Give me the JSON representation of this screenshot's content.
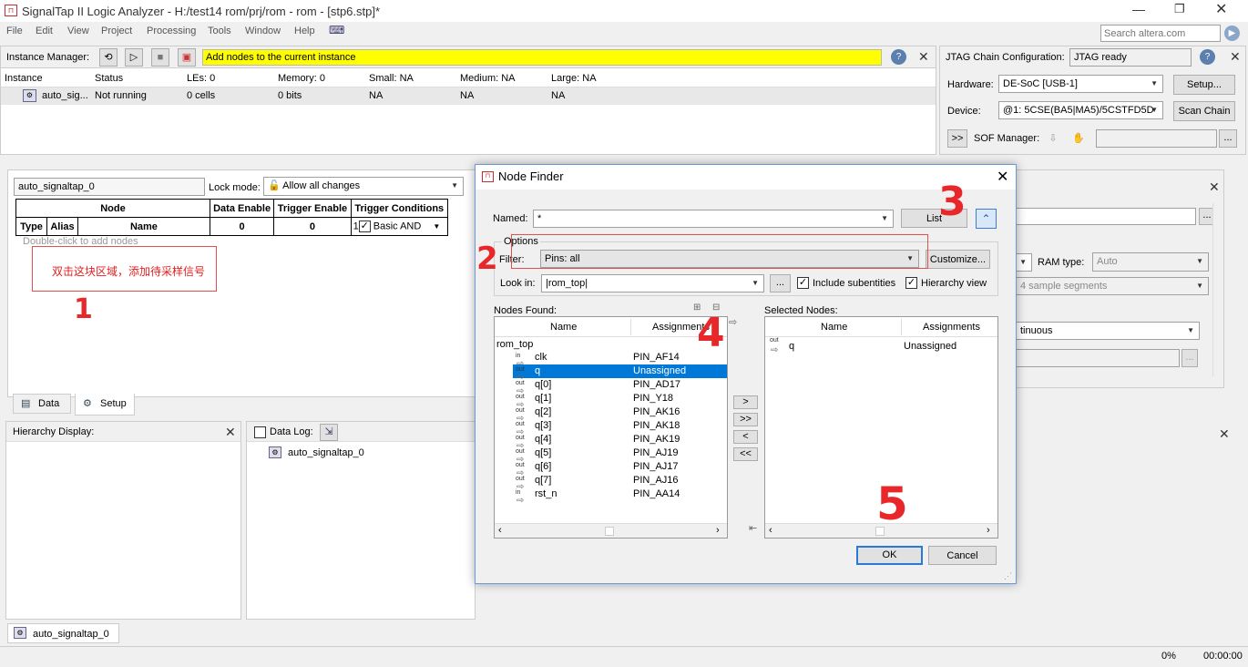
{
  "window": {
    "title": "SignalTap II Logic Analyzer - H:/test14 rom/prj/rom - rom - [stp6.stp]*",
    "search_placeholder": "Search altera.com"
  },
  "menu": [
    "File",
    "Edit",
    "View",
    "Project",
    "Processing",
    "Tools",
    "Window",
    "Help"
  ],
  "instance_manager": {
    "label": "Instance Manager:",
    "message": "Add nodes to the current instance",
    "columns": [
      "Instance",
      "Status",
      "LEs: 0",
      "Memory: 0",
      "Small: NA",
      "Medium: NA",
      "Large: NA"
    ],
    "row": [
      "auto_sig...",
      "Not running",
      "0 cells",
      "0 bits",
      "NA",
      "NA",
      "NA"
    ]
  },
  "jtag": {
    "label": "JTAG Chain Configuration:",
    "status": "JTAG ready",
    "hardware_label": "Hardware:",
    "hardware": "DE-SoC [USB-1]",
    "setup": "Setup...",
    "device_label": "Device:",
    "device": "@1: 5CSE(BA5|MA5)/5CSTFD5D",
    "scan_chain": "Scan Chain",
    "sof_button": ">>",
    "sof_label": "SOF Manager:"
  },
  "setup_pane": {
    "instance": "auto_signaltap_0",
    "lock_mode_label": "Lock mode:",
    "lock_mode": "Allow all changes",
    "headers": {
      "node": "Node",
      "data_enable": "Data Enable",
      "trigger_enable": "Trigger Enable",
      "trigger_conditions": "Trigger Conditions",
      "type": "Type",
      "alias": "Alias",
      "name": "Name",
      "data_count": "0",
      "trigger_count": "0",
      "cond_num": "1",
      "basic_and": "Basic AND"
    },
    "hint": "Double-click to add nodes",
    "note": "双击这块区域，添加待采样信号",
    "tabs": [
      "Data",
      "Setup"
    ]
  },
  "right_behind": {
    "ram_type_label": "RAM type:",
    "ram_type": "Auto",
    "sample_segments": "4 sample segments",
    "continuous": "tinuous"
  },
  "hierarchy": {
    "label": "Hierarchy Display:"
  },
  "data_log": {
    "label": "Data Log:",
    "item": "auto_signaltap_0"
  },
  "bottom_tab": "auto_signaltap_0",
  "status_bar": {
    "progress": "0%",
    "time": "00:00:00"
  },
  "node_finder": {
    "title": "Node Finder",
    "named_label": "Named:",
    "named_value": "*",
    "list_button": "List",
    "options_label": "Options",
    "filter_label": "Filter:",
    "filter_value": "Pins: all",
    "customize_button": "Customize...",
    "lookin_label": "Look in:",
    "lookin_value": "|rom_top|",
    "browse_button": "...",
    "include_subentities": "Include subentities",
    "hierarchy_view": "Hierarchy view",
    "nodes_found_label": "Nodes Found:",
    "selected_nodes_label": "Selected Nodes:",
    "col_name": "Name",
    "col_assignments": "Assignments",
    "root": "rom_top",
    "nodes": [
      {
        "dir": "in",
        "name": "clk",
        "assign": "PIN_AF14"
      },
      {
        "dir": "out",
        "name": "q",
        "assign": "Unassigned"
      },
      {
        "dir": "out",
        "name": "q[0]",
        "assign": "PIN_AD17"
      },
      {
        "dir": "out",
        "name": "q[1]",
        "assign": "PIN_Y18"
      },
      {
        "dir": "out",
        "name": "q[2]",
        "assign": "PIN_AK16"
      },
      {
        "dir": "out",
        "name": "q[3]",
        "assign": "PIN_AK18"
      },
      {
        "dir": "out",
        "name": "q[4]",
        "assign": "PIN_AK19"
      },
      {
        "dir": "out",
        "name": "q[5]",
        "assign": "PIN_AJ19"
      },
      {
        "dir": "out",
        "name": "q[6]",
        "assign": "PIN_AJ17"
      },
      {
        "dir": "out",
        "name": "q[7]",
        "assign": "PIN_AJ16"
      },
      {
        "dir": "in",
        "name": "rst_n",
        "assign": "PIN_AA14"
      }
    ],
    "selected": [
      {
        "dir": "out",
        "name": "q",
        "assign": "Unassigned"
      }
    ],
    "move_buttons": [
      ">",
      ">>",
      "<",
      "<<"
    ],
    "ok": "OK",
    "cancel": "Cancel"
  },
  "annotations": [
    "1",
    "2",
    "3",
    "4",
    "5"
  ],
  "colors": {
    "highlight": "#0078d7",
    "message_bg": "#ffff00",
    "annotation": "#e8272a"
  }
}
